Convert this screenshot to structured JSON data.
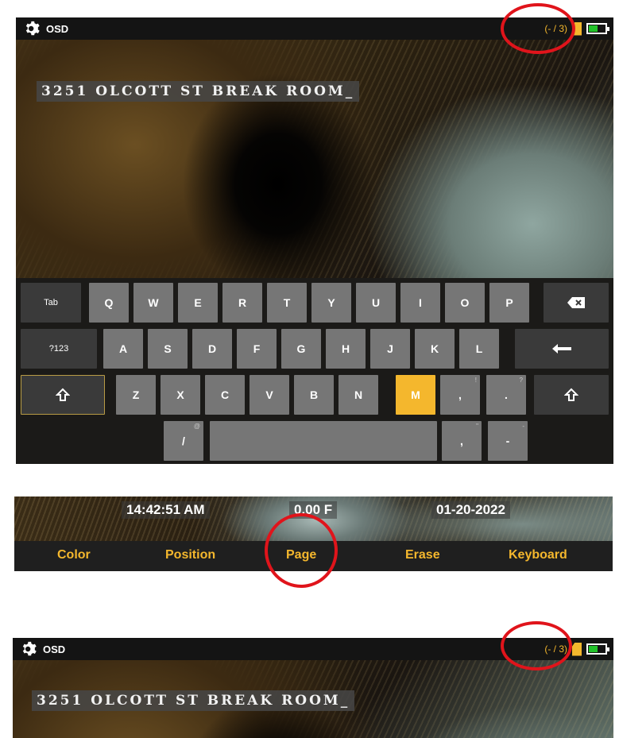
{
  "screen1": {
    "title": "OSD",
    "page_count": "(- / 3)",
    "overlay_text": "3251 OLCOTT ST BREAK ROOM",
    "cursor": "_"
  },
  "keyboard": {
    "tab": "Tab",
    "sym": "?123",
    "row1": [
      "Q",
      "W",
      "E",
      "R",
      "T",
      "Y",
      "U",
      "I",
      "O",
      "P"
    ],
    "row2": [
      "A",
      "S",
      "D",
      "F",
      "G",
      "H",
      "J",
      "K",
      "L"
    ],
    "row3": [
      "Z",
      "X",
      "C",
      "V",
      "B",
      "N",
      "M"
    ],
    "comma": ",",
    "comma_alt": "!",
    "period": ".",
    "period_alt": "?",
    "slash": "/",
    "slash_alt": "@",
    "comma2": ",",
    "comma2_alt": "\"",
    "dash": "-",
    "dash_alt": "-",
    "highlighted_key": "M"
  },
  "strip": {
    "time": "14:42:51 AM",
    "temp": "0.00 F",
    "date": "01-20-2022",
    "menu": [
      "Color",
      "Position",
      "Page",
      "Erase",
      "Keyboard"
    ]
  },
  "screen2": {
    "title": "OSD",
    "page_count": "(- / 3)",
    "overlay_text": "3251 OLCOTT ST BREAK ROOM",
    "cursor": "_"
  },
  "colors": {
    "accent": "#f4b72d",
    "highlight_ring": "#e0141b",
    "battery": "#22c22a"
  },
  "icons": [
    "gear-icon",
    "sd-card-icon",
    "battery-icon",
    "backspace-icon",
    "enter-icon",
    "shift-icon"
  ]
}
